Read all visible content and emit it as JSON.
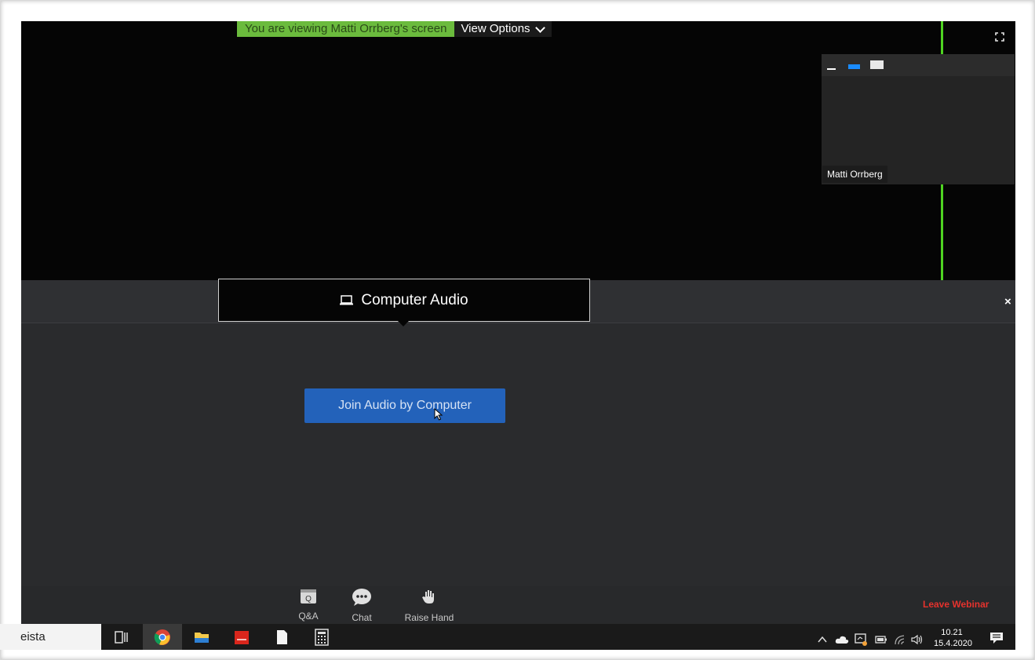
{
  "banner": {
    "viewing_text": "You are viewing Matti Orrberg's screen",
    "view_options_label": "View Options"
  },
  "participant": {
    "name": "Matti Orrberg"
  },
  "audio": {
    "tab_label": "Computer Audio",
    "join_button_label": "Join Audio by Computer",
    "close_label": "×"
  },
  "toolbar": {
    "qa_label": "Q&A",
    "chat_label": "Chat",
    "raise_hand_label": "Raise Hand",
    "leave_label": "Leave Webinar"
  },
  "taskbar": {
    "search_text": "eista",
    "time": "10.21",
    "date": "15.4.2020"
  },
  "colors": {
    "banner_green": "#6bbb3d",
    "speaker_border_green": "#4fd321",
    "join_button_blue": "#2362ba",
    "leave_red": "#e5322d",
    "panel_view_blue": "#1a8cff"
  },
  "icons": [
    "fullscreen-icon",
    "laptop-icon",
    "qa-icon",
    "chat-icon",
    "raise-hand-icon",
    "task-view-icon",
    "chrome-icon",
    "file-explorer-icon",
    "app-icon",
    "document-icon",
    "calculator-icon",
    "chevron-up-icon",
    "cloud-icon",
    "network-icon",
    "battery-icon",
    "wifi-icon",
    "volume-icon",
    "notification-icon",
    "mouse-cursor-icon"
  ]
}
